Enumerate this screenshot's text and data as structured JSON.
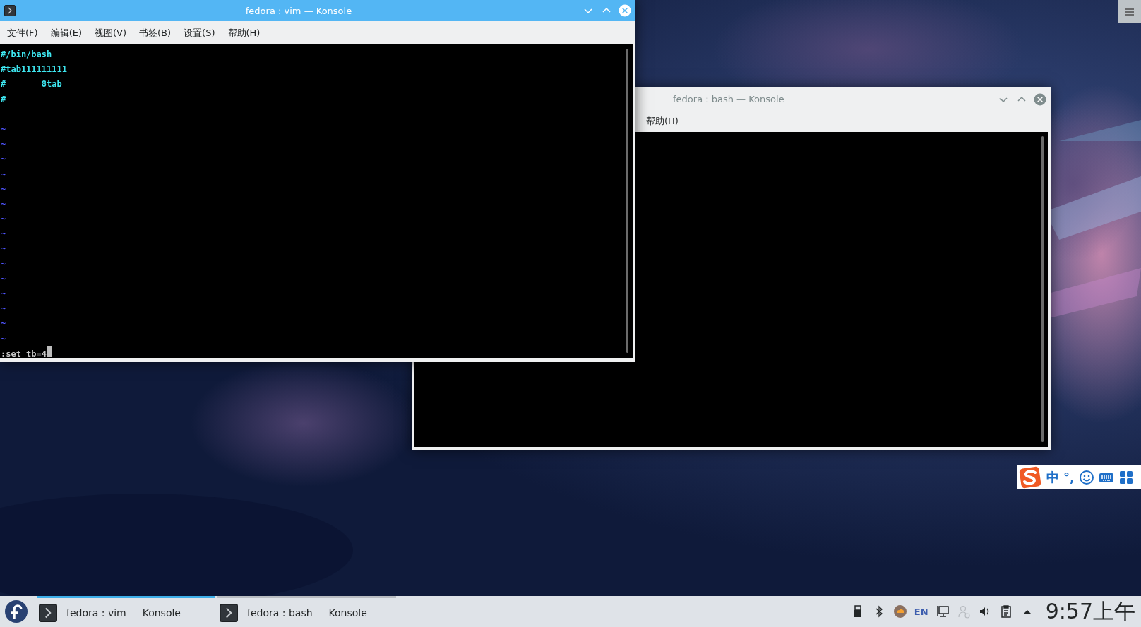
{
  "windows": [
    {
      "title": "fedora : vim — Konsole",
      "active": true,
      "menu": [
        "文件(F)",
        "编辑(E)",
        "视图(V)",
        "书签(B)",
        "设置(S)",
        "帮助(H)"
      ],
      "lines": [
        {
          "kind": "text",
          "text": "#/bin/bash"
        },
        {
          "kind": "text",
          "text": "#tab111111111"
        },
        {
          "kind": "text",
          "text": "#       8tab"
        },
        {
          "kind": "text",
          "text": "#"
        },
        {
          "kind": "blank"
        },
        {
          "kind": "tilde",
          "text": "~"
        },
        {
          "kind": "tilde",
          "text": "~"
        },
        {
          "kind": "tilde",
          "text": "~"
        },
        {
          "kind": "tilde",
          "text": "~"
        },
        {
          "kind": "tilde",
          "text": "~"
        },
        {
          "kind": "tilde",
          "text": "~"
        },
        {
          "kind": "tilde",
          "text": "~"
        },
        {
          "kind": "tilde",
          "text": "~"
        },
        {
          "kind": "tilde",
          "text": "~"
        },
        {
          "kind": "tilde",
          "text": "~"
        },
        {
          "kind": "tilde",
          "text": "~"
        },
        {
          "kind": "tilde",
          "text": "~"
        },
        {
          "kind": "tilde",
          "text": "~"
        },
        {
          "kind": "tilde",
          "text": "~"
        },
        {
          "kind": "tilde",
          "text": "~"
        }
      ],
      "command": ":set tb=4"
    },
    {
      "title": "fedora : bash — Konsole",
      "active": false,
      "menu": [
        "帮助(H)"
      ]
    }
  ],
  "ime_bar": {
    "mode": "中",
    "punctuation": "°,"
  },
  "taskbar": {
    "tasks": [
      {
        "label": "fedora : vim — Konsole",
        "selected": true
      },
      {
        "label": "fedora : bash — Konsole",
        "selected": false
      }
    ],
    "tray_language": "EN",
    "clock": "9:57上午"
  }
}
